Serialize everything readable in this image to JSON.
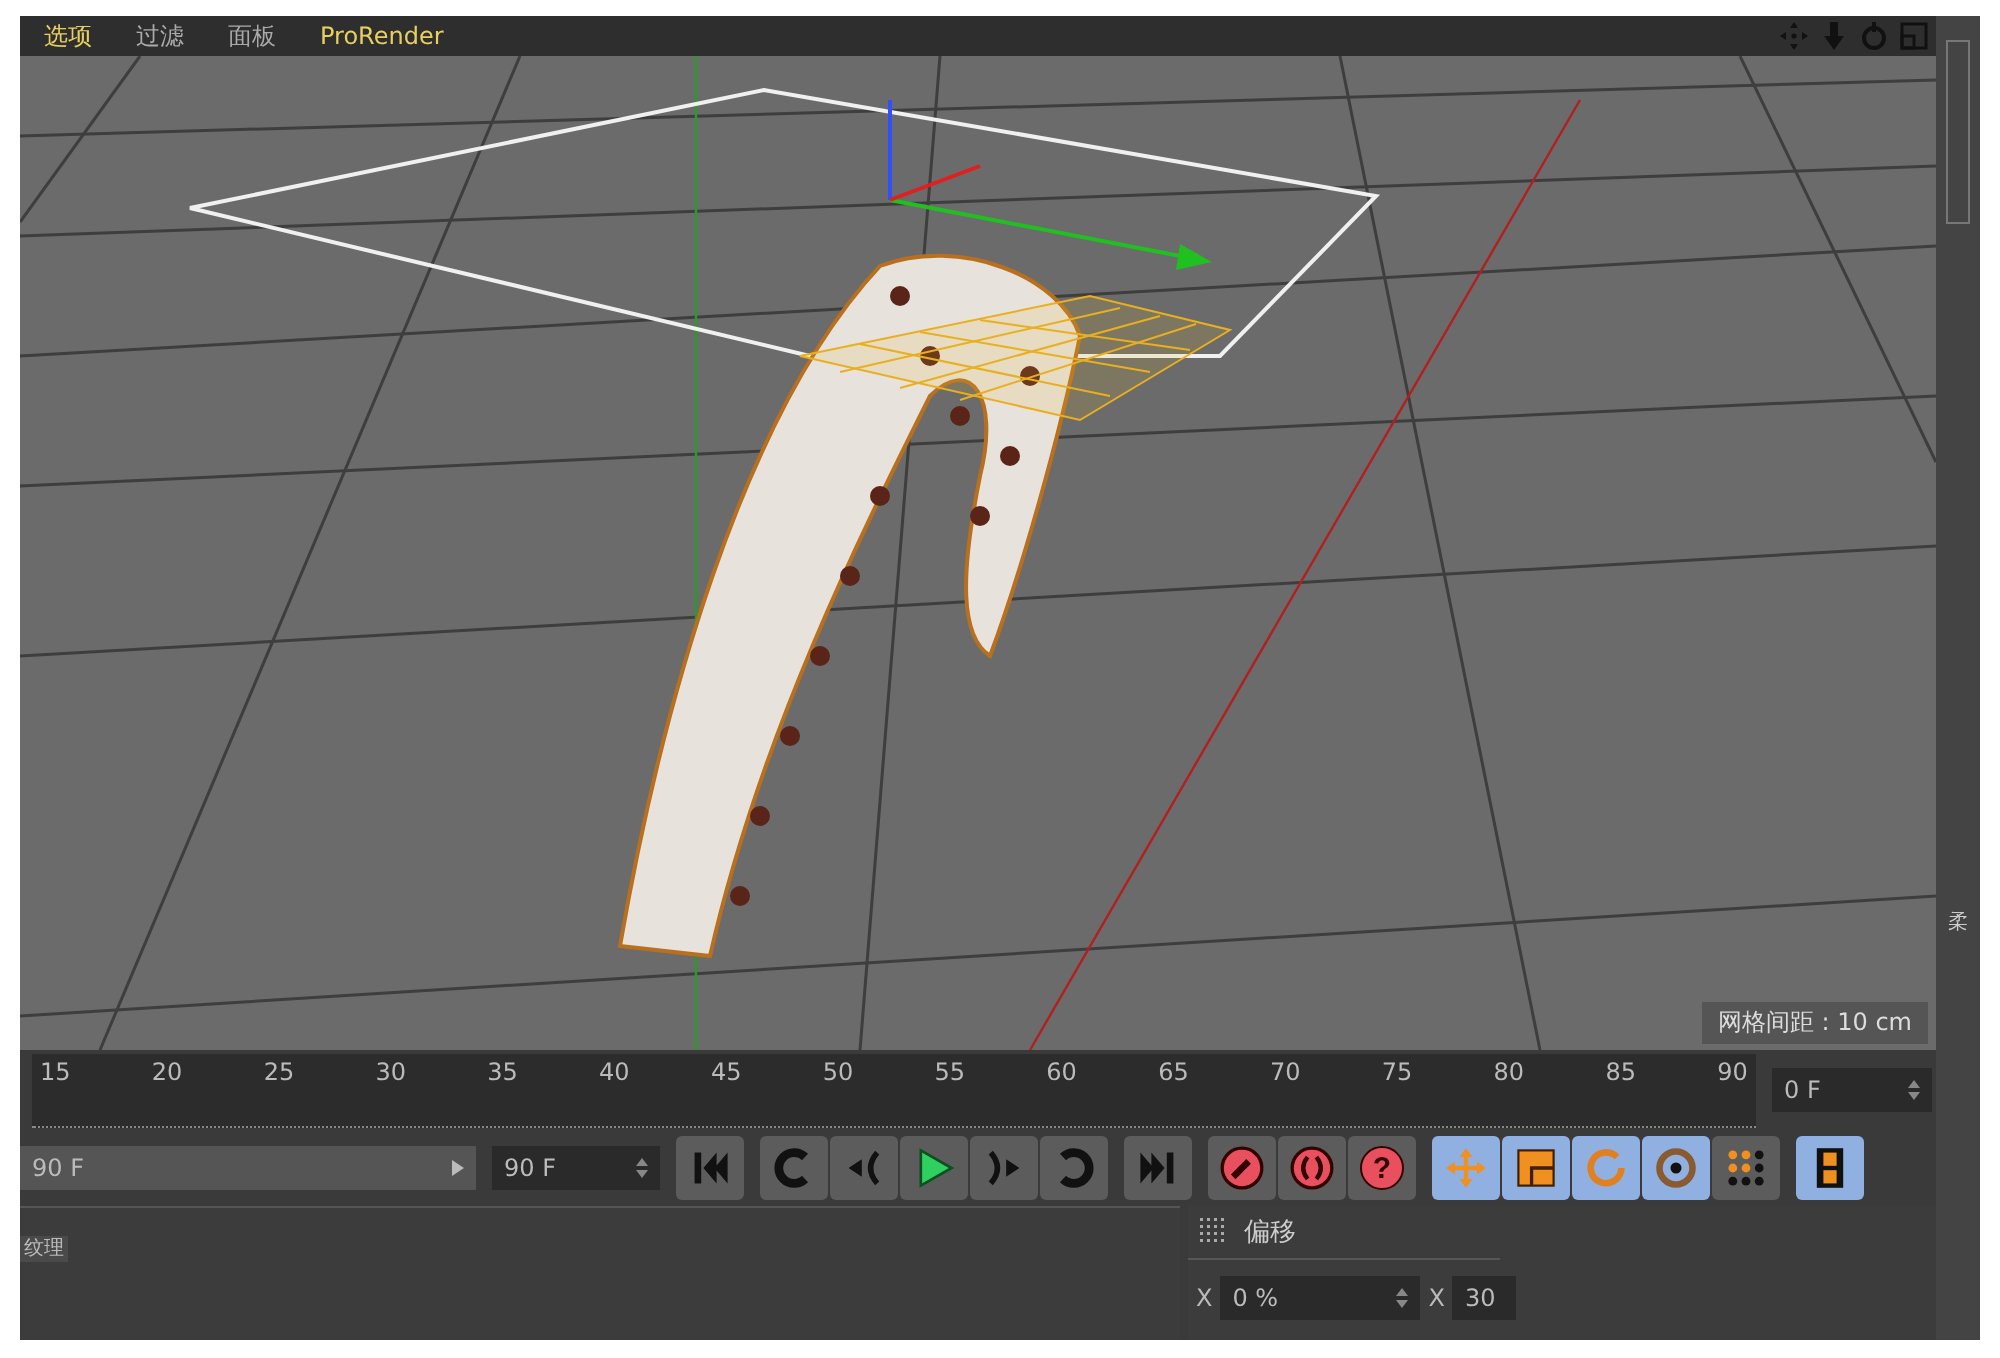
{
  "menu": [
    {
      "label": "选项",
      "highlighted": true
    },
    {
      "label": "过滤",
      "highlighted": false
    },
    {
      "label": "面板",
      "highlighted": false
    },
    {
      "label": "ProRender",
      "highlighted": true
    }
  ],
  "viewport": {
    "grid_spacing": "网格间距 : 10 cm"
  },
  "timeline": {
    "ticks": [
      "15",
      "20",
      "25",
      "30",
      "35",
      "40",
      "45",
      "50",
      "55",
      "60",
      "65",
      "70",
      "75",
      "80",
      "85",
      "90"
    ],
    "current_frame": "0 F"
  },
  "controls": {
    "start_field": "90 F",
    "end_field": "90 F",
    "groups": [
      [
        {
          "kind": "go-start",
          "selected": false
        }
      ],
      [
        {
          "kind": "loop-back",
          "selected": false
        },
        {
          "kind": "prev-key",
          "selected": false
        },
        {
          "kind": "play",
          "selected": false
        },
        {
          "kind": "next-key",
          "selected": false
        },
        {
          "kind": "loop-forward",
          "selected": false
        }
      ],
      [
        {
          "kind": "go-end",
          "selected": false
        }
      ],
      [
        {
          "kind": "record",
          "selected": false
        },
        {
          "kind": "autokey",
          "selected": false
        },
        {
          "kind": "help",
          "label": "?",
          "selected": false
        }
      ],
      [
        {
          "kind": "move",
          "selected": true
        },
        {
          "kind": "scale",
          "selected": true
        },
        {
          "kind": "rotate",
          "selected": true
        },
        {
          "kind": "ring",
          "selected": true
        },
        {
          "kind": "dots",
          "selected": false
        }
      ],
      [
        {
          "kind": "film",
          "selected": true
        }
      ]
    ]
  },
  "left_panel": {
    "tab": "纹理"
  },
  "attributes": {
    "title": "偏移",
    "fields": [
      {
        "axis": "X",
        "value": "0 %"
      },
      {
        "axis": "X",
        "value": "30"
      }
    ]
  },
  "side_tab": "柔"
}
